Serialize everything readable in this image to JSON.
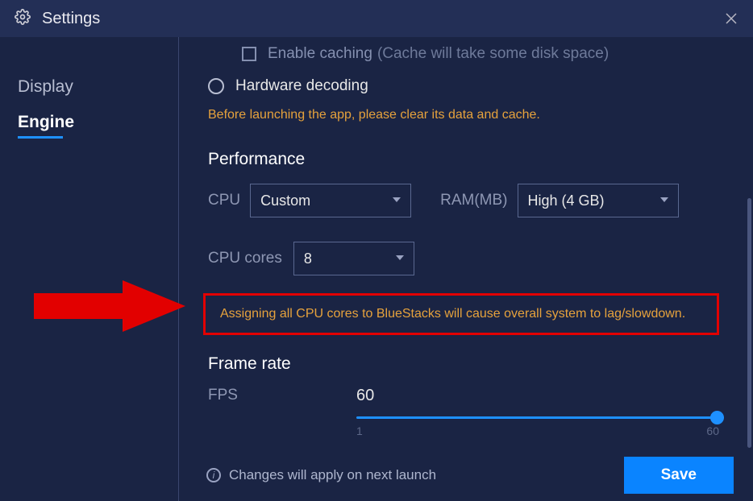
{
  "titlebar": {
    "title": "Settings"
  },
  "sidebar": {
    "items": [
      {
        "label": "Display"
      },
      {
        "label": "Engine"
      }
    ]
  },
  "caching": {
    "label": "Enable caching",
    "hint": "(Cache will take some disk space)"
  },
  "hw_decoding": {
    "label": "Hardware decoding"
  },
  "warn_pre": "Before launching the app, please clear its data and cache.",
  "performance": {
    "title": "Performance",
    "cpu_label": "CPU",
    "cpu_value": "Custom",
    "ram_label": "RAM(MB)",
    "ram_value": "High (4 GB)",
    "cores_label": "CPU cores",
    "cores_value": "8",
    "warn_cores": "Assigning all CPU cores to BlueStacks will cause overall system to lag/slowdown."
  },
  "frame_rate": {
    "title": "Frame rate",
    "fps_label": "FPS",
    "fps_value": "60",
    "min": "1",
    "max": "60"
  },
  "footer": {
    "note": "Changes will apply on next launch",
    "save": "Save"
  }
}
